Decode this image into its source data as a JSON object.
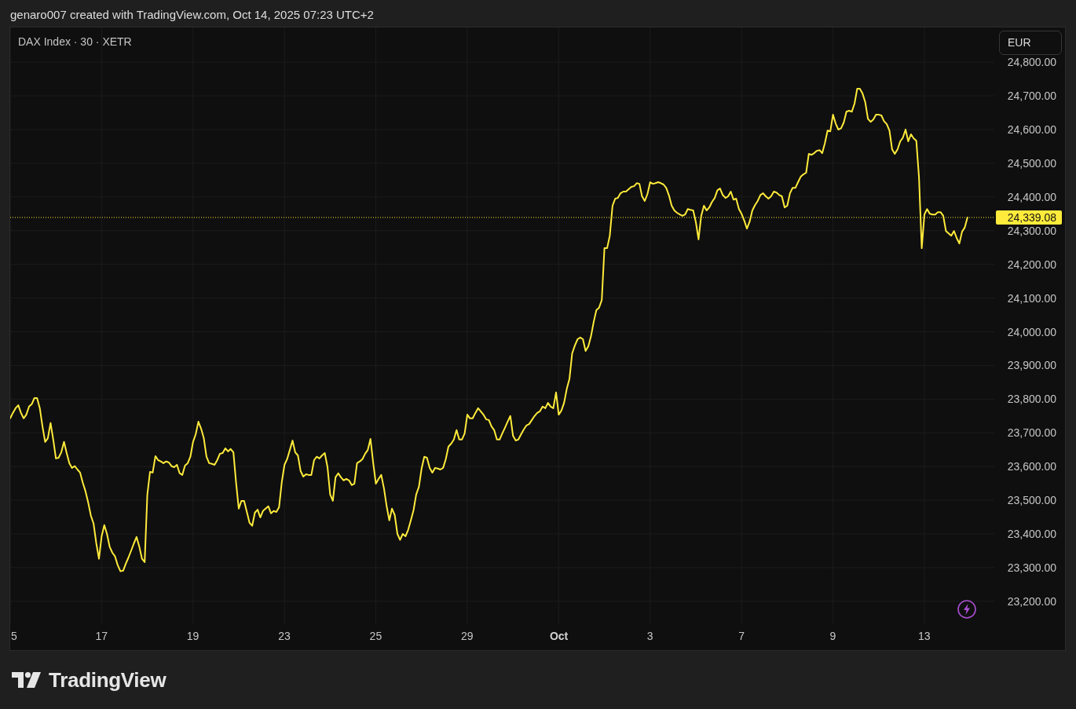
{
  "header": {
    "attribution": "genaro007 created with TradingView.com, Oct 14, 2025 07:23 UTC+2"
  },
  "chart": {
    "currency": "EUR",
    "chart_data": {
      "type": "line",
      "title": "DAX Index · 30 · XETR",
      "grid": true,
      "categories": [
        "5",
        null,
        null,
        null,
        null,
        null,
        null,
        null,
        null,
        null,
        null,
        null,
        null,
        null,
        null,
        null,
        null,
        null,
        null,
        null,
        null,
        null,
        null,
        null,
        null,
        null,
        null,
        null,
        null,
        null,
        null,
        null,
        null,
        null,
        "17",
        null,
        null,
        null,
        null,
        null,
        null,
        null,
        null,
        null,
        null,
        null,
        null,
        null,
        null,
        null,
        null,
        null,
        null,
        null,
        null,
        null,
        null,
        null,
        null,
        null,
        null,
        null,
        null,
        null,
        null,
        null,
        null,
        null,
        "19",
        null,
        null,
        null,
        null,
        null,
        null,
        null,
        null,
        null,
        null,
        null,
        null,
        null,
        null,
        null,
        null,
        null,
        null,
        null,
        null,
        null,
        null,
        null,
        null,
        null,
        null,
        null,
        null,
        null,
        null,
        null,
        null,
        null,
        "23",
        null,
        null,
        null,
        null,
        null,
        null,
        null,
        null,
        null,
        null,
        null,
        null,
        null,
        null,
        null,
        null,
        null,
        null,
        null,
        null,
        null,
        null,
        null,
        null,
        null,
        null,
        null,
        null,
        null,
        null,
        null,
        null,
        null,
        "25",
        null,
        null,
        null,
        null,
        null,
        null,
        null,
        null,
        null,
        null,
        null,
        null,
        null,
        null,
        null,
        null,
        null,
        null,
        null,
        null,
        null,
        null,
        null,
        null,
        null,
        null,
        null,
        null,
        null,
        null,
        null,
        null,
        null,
        "29",
        null,
        null,
        null,
        null,
        null,
        null,
        null,
        null,
        null,
        null,
        null,
        null,
        null,
        null,
        null,
        null,
        null,
        null,
        null,
        null,
        null,
        null,
        null,
        null,
        null,
        null,
        null,
        null,
        null,
        null,
        null,
        null,
        null,
        "Oct",
        null,
        null,
        null,
        null,
        null,
        null,
        null,
        null,
        null,
        null,
        null,
        null,
        null,
        null,
        null,
        null,
        null,
        null,
        null,
        null,
        null,
        null,
        null,
        null,
        null,
        null,
        null,
        null,
        null,
        null,
        null,
        null,
        null,
        "3",
        null,
        null,
        null,
        null,
        null,
        null,
        null,
        null,
        null,
        null,
        null,
        null,
        null,
        null,
        null,
        null,
        null,
        null,
        null,
        null,
        null,
        null,
        null,
        null,
        null,
        null,
        null,
        null,
        null,
        null,
        null,
        null,
        null,
        "7",
        null,
        null,
        null,
        null,
        null,
        null,
        null,
        null,
        null,
        null,
        null,
        null,
        null,
        null,
        null,
        null,
        null,
        null,
        null,
        null,
        null,
        null,
        null,
        null,
        null,
        null,
        null,
        null,
        null,
        null,
        null,
        null,
        null,
        "9",
        null,
        null,
        null,
        null,
        null,
        null,
        null,
        null,
        null,
        null,
        null,
        null,
        null,
        null,
        null,
        null,
        null,
        null,
        null,
        null,
        null,
        null,
        null,
        null,
        null,
        null,
        null,
        null,
        null,
        null,
        null,
        null,
        null,
        "13",
        null,
        null,
        null,
        null,
        null,
        null,
        null,
        null,
        null,
        null,
        null,
        null,
        null,
        null,
        null,
        null,
        null,
        null,
        null,
        null,
        null,
        null,
        null,
        null,
        null,
        null
      ],
      "series": [
        {
          "color": "#ffeb3b",
          "values": [
            23743,
            23759,
            23773,
            23782,
            23759,
            23743,
            23754,
            23778,
            23785,
            23803,
            23803,
            23773,
            23719,
            23673,
            23684,
            23729,
            23680,
            23624,
            23626,
            23642,
            23673,
            23640,
            23610,
            23596,
            23601,
            23591,
            23582,
            23552,
            23526,
            23493,
            23454,
            23431,
            23372,
            23326,
            23393,
            23426,
            23400,
            23361,
            23344,
            23333,
            23307,
            23289,
            23291,
            23312,
            23330,
            23351,
            23372,
            23391,
            23363,
            23326,
            23316,
            23517,
            23584,
            23582,
            23631,
            23619,
            23615,
            23610,
            23615,
            23612,
            23601,
            23598,
            23605,
            23580,
            23575,
            23603,
            23610,
            23629,
            23673,
            23696,
            23733,
            23712,
            23684,
            23629,
            23610,
            23608,
            23605,
            23619,
            23638,
            23640,
            23654,
            23645,
            23652,
            23642,
            23552,
            23475,
            23498,
            23498,
            23465,
            23433,
            23424,
            23463,
            23472,
            23449,
            23468,
            23475,
            23482,
            23461,
            23468,
            23465,
            23479,
            23554,
            23605,
            23622,
            23649,
            23677,
            23642,
            23633,
            23587,
            23570,
            23577,
            23575,
            23575,
            23619,
            23629,
            23624,
            23633,
            23640,
            23598,
            23517,
            23498,
            23568,
            23580,
            23568,
            23559,
            23563,
            23559,
            23545,
            23549,
            23610,
            23615,
            23622,
            23638,
            23649,
            23682,
            23610,
            23549,
            23563,
            23575,
            23535,
            23482,
            23440,
            23475,
            23456,
            23400,
            23382,
            23400,
            23393,
            23412,
            23440,
            23470,
            23517,
            23540,
            23594,
            23629,
            23626,
            23596,
            23582,
            23596,
            23594,
            23591,
            23596,
            23622,
            23659,
            23668,
            23680,
            23708,
            23680,
            23680,
            23698,
            23754,
            23743,
            23743,
            23759,
            23773,
            23764,
            23754,
            23740,
            23738,
            23719,
            23708,
            23680,
            23680,
            23698,
            23715,
            23733,
            23750,
            23691,
            23677,
            23680,
            23696,
            23710,
            23722,
            23726,
            23738,
            23750,
            23759,
            23764,
            23778,
            23773,
            23789,
            23778,
            23773,
            23820,
            23754,
            23766,
            23789,
            23831,
            23861,
            23936,
            23959,
            23978,
            23983,
            23978,
            23943,
            23957,
            23987,
            24029,
            24064,
            24071,
            24094,
            24248,
            24248,
            24285,
            24374,
            24395,
            24397,
            24411,
            24416,
            24416,
            24423,
            24430,
            24432,
            24441,
            24439,
            24402,
            24388,
            24409,
            24444,
            24439,
            24441,
            24444,
            24441,
            24437,
            24427,
            24404,
            24374,
            24360,
            24353,
            24348,
            24344,
            24348,
            24364,
            24362,
            24360,
            24325,
            24274,
            24344,
            24374,
            24360,
            24369,
            24385,
            24397,
            24420,
            24425,
            24406,
            24397,
            24402,
            24416,
            24392,
            24395,
            24364,
            24350,
            24330,
            24306,
            24327,
            24360,
            24376,
            24388,
            24406,
            24411,
            24402,
            24395,
            24402,
            24416,
            24413,
            24406,
            24402,
            24369,
            24374,
            24411,
            24427,
            24427,
            24444,
            24460,
            24467,
            24472,
            24528,
            24525,
            24530,
            24537,
            24539,
            24530,
            24560,
            24597,
            24595,
            24644,
            24618,
            24600,
            24604,
            24621,
            24653,
            24656,
            24653,
            24677,
            24721,
            24721,
            24707,
            24681,
            24632,
            24623,
            24630,
            24644,
            24644,
            24642,
            24625,
            24616,
            24597,
            24541,
            24528,
            24541,
            24565,
            24576,
            24600,
            24565,
            24586,
            24574,
            24567,
            24458,
            24248,
            24348,
            24364,
            24350,
            24348,
            24348,
            24355,
            24355,
            24344,
            24299,
            24292,
            24285,
            24299,
            24278,
            24262,
            24297,
            24309,
            24339,
            null,
            null,
            null,
            null,
            null,
            null,
            null,
            null,
            null,
            null
          ]
        }
      ],
      "ylim": [
        23132,
        24903
      ],
      "yticks": [
        {
          "value": 24800,
          "label": "24,800.00"
        },
        {
          "value": 24700,
          "label": "24,700.00"
        },
        {
          "value": 24600,
          "label": "24,600.00"
        },
        {
          "value": 24500,
          "label": "24,500.00"
        },
        {
          "value": 24400,
          "label": "24,400.00"
        },
        {
          "value": 24300,
          "label": "24,300.00"
        },
        {
          "value": 24200,
          "label": "24,200.00"
        },
        {
          "value": 24100,
          "label": "24,100.00"
        },
        {
          "value": 24000,
          "label": "24,000.00"
        },
        {
          "value": 23900,
          "label": "23,900.00"
        },
        {
          "value": 23800,
          "label": "23,800.00"
        },
        {
          "value": 23700,
          "label": "23,700.00"
        },
        {
          "value": 23600,
          "label": "23,600.00"
        },
        {
          "value": 23500,
          "label": "23,500.00"
        },
        {
          "value": 23400,
          "label": "23,400.00"
        },
        {
          "value": 23300,
          "label": "23,300.00"
        },
        {
          "value": 23200,
          "label": "23,200.00"
        }
      ],
      "ref_lines": [
        {
          "axis": "y",
          "value": 24339.08,
          "label": "24,339.08"
        }
      ]
    }
  },
  "footer": {
    "brand": "TradingView"
  }
}
